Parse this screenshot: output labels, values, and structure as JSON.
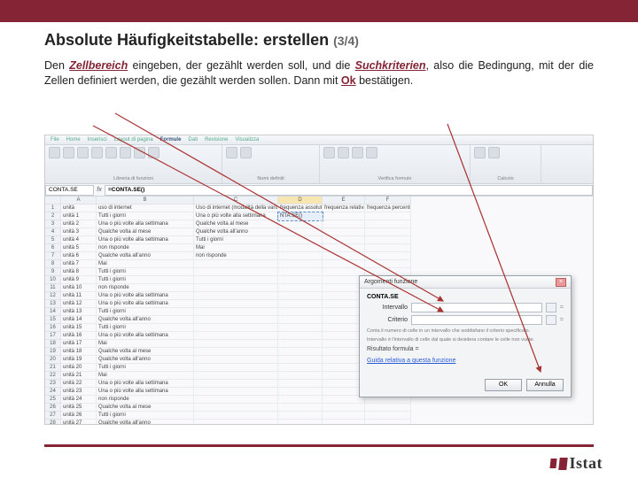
{
  "page": {
    "title": "Absolute Häufigkeitstabelle: erstellen",
    "pager": "(3/4)"
  },
  "intro": {
    "t1": "Den ",
    "em1": "Zellbereich",
    "t2": " eingeben, der gezählt werden soll, und die ",
    "em2": "Suchkriterien",
    "t3": ", also die Bedingung, mit der die Zellen definiert werden, die gezählt werden sollen. Dann mit ",
    "ok": "Ok",
    "t4": " bestätigen."
  },
  "ribbon": {
    "menus": [
      "File",
      "Home",
      "Inserisci",
      "Layout di pagina",
      "Formule",
      "Dati",
      "Revisione",
      "Visualizza"
    ],
    "groups": [
      "Libreria di funzioni",
      "Nomi definiti",
      "Verifica formule",
      "Calcolo"
    ]
  },
  "fx": {
    "namebox": "CONTA.SE",
    "fx": "fx",
    "formula": "=CONTA.SE()"
  },
  "sheet": {
    "cols": [
      "",
      "A",
      "B",
      "C",
      "D",
      "E",
      "F"
    ],
    "header_row": [
      "1",
      "unità",
      "uso di internet",
      "Uso di internet (modalità della variabile)",
      "frequenza assoluta",
      "frequenza relativa",
      "frequenza percentuale"
    ],
    "c_formula": "NTA.SE()",
    "rows": [
      [
        "2",
        "unità 1",
        "Tutti i giorni",
        "Una o più volte alla settimana",
        "",
        "",
        ""
      ],
      [
        "3",
        "unità 2",
        "Una o più volte alla settimana",
        "Qualche volta al mese",
        "",
        "",
        ""
      ],
      [
        "4",
        "unità 3",
        "Qualche volta al mese",
        "Qualche volta all'anno",
        "",
        "",
        ""
      ],
      [
        "5",
        "unità 4",
        "Una o più volte alla settimana",
        "Tutti i giorni",
        "",
        "",
        ""
      ],
      [
        "6",
        "unità 5",
        "non risponde",
        "Mai",
        "",
        "",
        ""
      ],
      [
        "7",
        "unità 6",
        "Qualche volta all'anno",
        "non risponde",
        "",
        "",
        ""
      ],
      [
        "8",
        "unità 7",
        "Mai",
        "",
        "",
        "",
        ""
      ],
      [
        "9",
        "unità 8",
        "Tutti i giorni",
        "",
        "",
        "",
        ""
      ],
      [
        "10",
        "unità 9",
        "Tutti i giorni",
        "",
        "",
        "",
        ""
      ],
      [
        "11",
        "unità 10",
        "non risponde",
        "",
        "",
        "",
        ""
      ],
      [
        "12",
        "unità 11",
        "Una o più volte alla settimana",
        "",
        "",
        "",
        ""
      ],
      [
        "13",
        "unità 12",
        "Una o più volte alla settimana",
        "",
        "",
        "",
        ""
      ],
      [
        "14",
        "unità 13",
        "Tutti i giorni",
        "",
        "",
        "",
        ""
      ],
      [
        "15",
        "unità 14",
        "Qualche volta all'anno",
        "",
        "",
        "",
        ""
      ],
      [
        "16",
        "unità 15",
        "Tutti i giorni",
        "",
        "",
        "",
        ""
      ],
      [
        "17",
        "unità 16",
        "Una o più volte alla settimana",
        "",
        "",
        "",
        ""
      ],
      [
        "18",
        "unità 17",
        "Mai",
        "",
        "",
        "",
        ""
      ],
      [
        "19",
        "unità 18",
        "Qualche volta al mese",
        "",
        "",
        "",
        ""
      ],
      [
        "20",
        "unità 19",
        "Qualche volta all'anno",
        "",
        "",
        "",
        ""
      ],
      [
        "21",
        "unità 20",
        "Tutti i giorni",
        "",
        "",
        "",
        ""
      ],
      [
        "22",
        "unità 21",
        "Mai",
        "",
        "",
        "",
        ""
      ],
      [
        "23",
        "unità 22",
        "Una o più volte alla settimana",
        "",
        "",
        "",
        ""
      ],
      [
        "24",
        "unità 23",
        "Una o più volte alla settimana",
        "",
        "",
        "",
        ""
      ],
      [
        "25",
        "unità 24",
        "non risponde",
        "",
        "",
        "",
        ""
      ],
      [
        "26",
        "unità 25",
        "Qualche volta al mese",
        "",
        "",
        "",
        ""
      ],
      [
        "27",
        "unità 26",
        "Tutti i giorni",
        "",
        "",
        "",
        ""
      ],
      [
        "28",
        "unità 27",
        "Qualche volta all'anno",
        "",
        "",
        "",
        ""
      ]
    ]
  },
  "dialog": {
    "title": "Argomenti funzione",
    "func": "CONTA.SE",
    "lbl_range": "Intervallo",
    "lbl_crit": "Criterio",
    "val_range": "",
    "val_crit": "",
    "hint_eq": "=",
    "desc1": "Conta il numero di celle in un intervallo che soddisfano il criterio specificato.",
    "desc2": "Intervallo è l'intervallo di celle dal quale si desidera contare le celle non vuote.",
    "result": "Risultato formula =",
    "help": "Guida relativa a questa funzione",
    "ok": "OK",
    "cancel": "Annulla"
  },
  "logo": {
    "text": "Istat"
  }
}
